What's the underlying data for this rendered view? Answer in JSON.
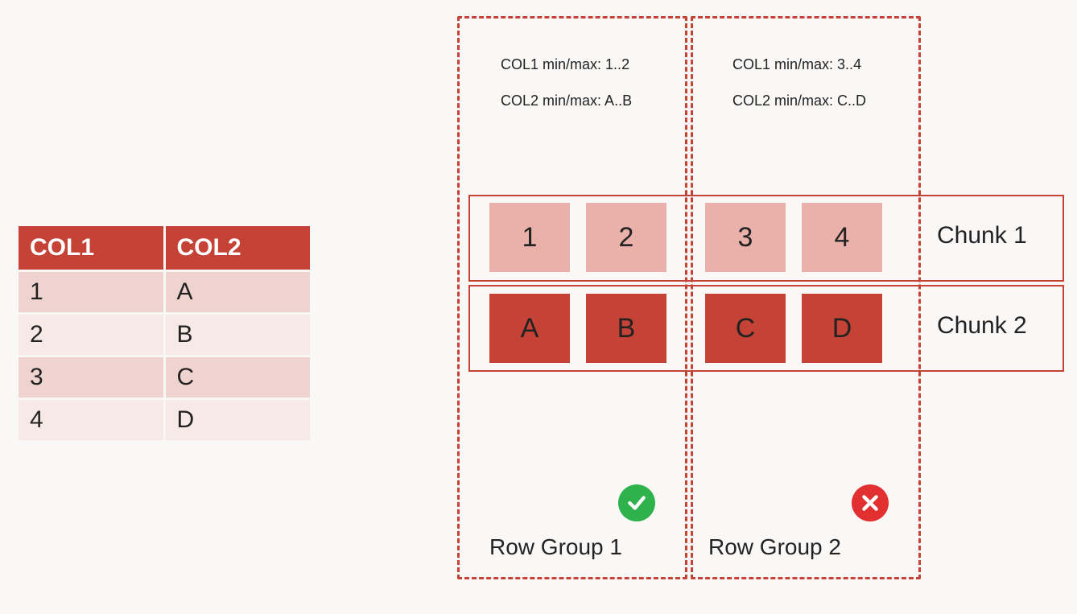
{
  "table": {
    "headers": [
      "COL1",
      "COL2"
    ],
    "rows": [
      [
        "1",
        "A"
      ],
      [
        "2",
        "B"
      ],
      [
        "3",
        "C"
      ],
      [
        "4",
        "D"
      ]
    ]
  },
  "diagram": {
    "meta1_line1": "COL1 min/max: 1..2",
    "meta1_line2": "COL2 min/max: A..B",
    "meta2_line1": "COL1 min/max: 3..4",
    "meta2_line2": "COL2 min/max: C..D",
    "chunk1_label": "Chunk 1",
    "chunk2_label": "Chunk 2",
    "chunk1_cells": [
      "1",
      "2",
      "3",
      "4"
    ],
    "chunk2_cells": [
      "A",
      "B",
      "C",
      "D"
    ],
    "rowgroup1_label": "Row Group 1",
    "rowgroup2_label": "Row Group 2",
    "rowgroup1_status": "ok",
    "rowgroup2_status": "fail"
  },
  "colors": {
    "accent": "#c54336",
    "cell_light": "#e9b1a9",
    "cell_dark": "#c54336",
    "ok": "#2fb24c",
    "fail": "#e22f2f",
    "bg": "#faf8f7"
  }
}
